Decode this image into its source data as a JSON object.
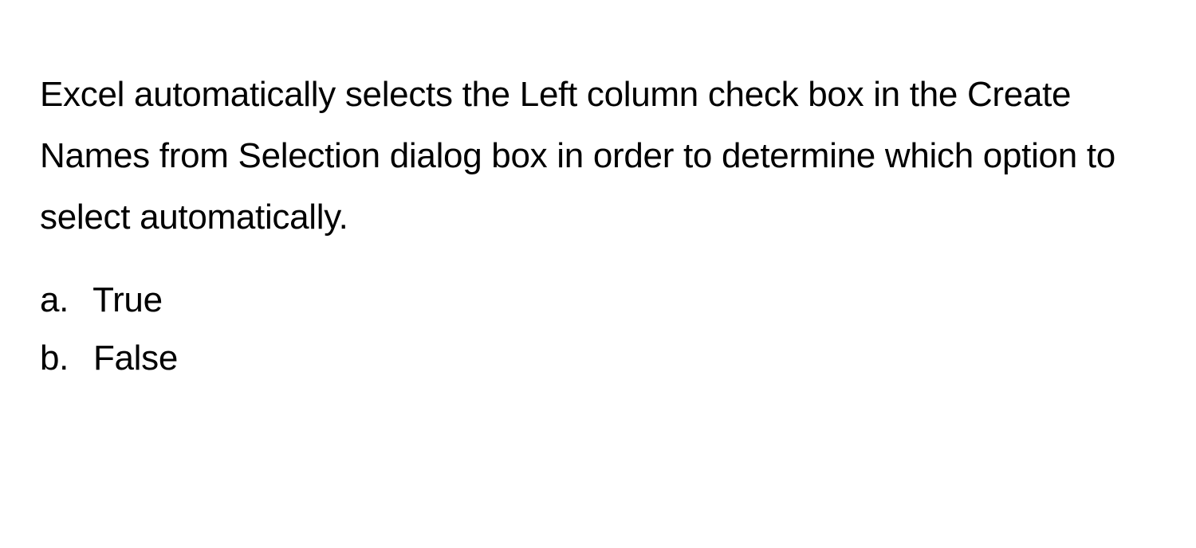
{
  "question": {
    "text": "Excel automatically selects the Left column check box in the Create Names from Selection dialog box in order to determine which option to select automatically.",
    "options": [
      {
        "letter": "a.",
        "label": "True"
      },
      {
        "letter": "b.",
        "label": "False"
      }
    ]
  }
}
